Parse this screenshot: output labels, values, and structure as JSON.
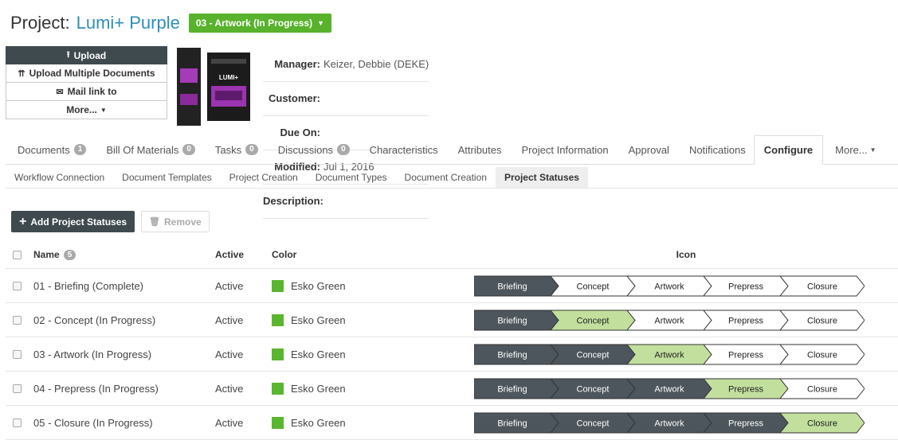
{
  "header": {
    "label": "Project:",
    "name": "Lumi+ Purple",
    "status": "03 - Artwork (In Progress)"
  },
  "actions": {
    "upload": "Upload",
    "upload_multiple": "Upload Multiple Documents",
    "mail_link": "Mail link to",
    "more": "More..."
  },
  "meta": {
    "manager_label": "Manager:",
    "manager": "Keizer, Debbie (DEKE)",
    "customer_label": "Customer:",
    "customer": "",
    "due_label": "Due On:",
    "due": "",
    "modified_label": "Modified:",
    "modified": "Jul 1, 2016",
    "description_label": "Description:",
    "description": ""
  },
  "tabs": [
    {
      "label": "Documents",
      "badge": "1"
    },
    {
      "label": "Bill Of Materials",
      "badge": "0"
    },
    {
      "label": "Tasks",
      "badge": "0"
    },
    {
      "label": "Discussions",
      "badge": "0"
    },
    {
      "label": "Characteristics",
      "badge": ""
    },
    {
      "label": "Attributes",
      "badge": ""
    },
    {
      "label": "Project Information",
      "badge": ""
    },
    {
      "label": "Approval",
      "badge": ""
    },
    {
      "label": "Notifications",
      "badge": ""
    },
    {
      "label": "Configure",
      "badge": ""
    },
    {
      "label": "More...",
      "badge": ""
    }
  ],
  "subtabs": [
    "Workflow Connection",
    "Document Templates",
    "Project Creation",
    "Document Types",
    "Document Creation",
    "Project Statuses"
  ],
  "toolbar": {
    "add": "Add Project Statuses",
    "remove": "Remove"
  },
  "table": {
    "headers": {
      "name": "Name",
      "count": "5",
      "active": "Active",
      "color": "Color",
      "icon": "Icon"
    },
    "stages": [
      "Briefing",
      "Concept",
      "Artwork",
      "Prepress",
      "Closure"
    ],
    "rows": [
      {
        "name": "01 - Briefing (Complete)",
        "active": "Active",
        "color": "Esko Green",
        "current": 0
      },
      {
        "name": "02 - Concept (In Progress)",
        "active": "Active",
        "color": "Esko Green",
        "current": 1
      },
      {
        "name": "03 - Artwork (In Progress)",
        "active": "Active",
        "color": "Esko Green",
        "current": 2
      },
      {
        "name": "04 - Prepress (In Progress)",
        "active": "Active",
        "color": "Esko Green",
        "current": 3
      },
      {
        "name": "05 - Closure (In Progress)",
        "active": "Active",
        "color": "Esko Green",
        "current": 4
      }
    ]
  },
  "colors": {
    "accent": "#58b22c",
    "done": "#4d565c",
    "current": "#c2df9e",
    "todo": "#ffffff",
    "link": "#2e8fb8"
  }
}
